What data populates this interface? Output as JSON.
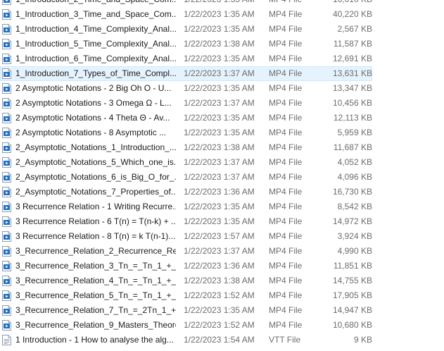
{
  "files": [
    {
      "name": "1_Introduction_2_Time_and_Space_Com...",
      "date": "1/22/2023 1:35 AM",
      "type": "MP4 File",
      "size": "16,010 KB",
      "icon": "video-file-icon",
      "selected": false
    },
    {
      "name": "1_Introduction_3_Time_and_Space_Com...",
      "date": "1/22/2023 1:35 AM",
      "type": "MP4 File",
      "size": "40,220 KB",
      "icon": "video-file-icon",
      "selected": false
    },
    {
      "name": "1_Introduction_4_Time_Complexity_Anal...",
      "date": "1/22/2023 1:35 AM",
      "type": "MP4 File",
      "size": "2,567 KB",
      "icon": "video-file-icon",
      "selected": false
    },
    {
      "name": "1_Introduction_5_Time_Complexity_Anal...",
      "date": "1/22/2023 1:38 AM",
      "type": "MP4 File",
      "size": "11,587 KB",
      "icon": "video-file-icon",
      "selected": false
    },
    {
      "name": "1_Introduction_6_Time_Complexity_Anal...",
      "date": "1/22/2023 1:35 AM",
      "type": "MP4 File",
      "size": "12,691 KB",
      "icon": "video-file-icon",
      "selected": false
    },
    {
      "name": "1_Introduction_7_Types_of_Time_Compl...",
      "date": "1/22/2023 1:37 AM",
      "type": "MP4 File",
      "size": "13,631 KB",
      "icon": "video-file-icon",
      "selected": true
    },
    {
      "name": "2 Asymptotic Notations - 2 Big Oh O - U...",
      "date": "1/22/2023 1:35 AM",
      "type": "MP4 File",
      "size": "13,347 KB",
      "icon": "video-file-icon",
      "selected": false
    },
    {
      "name": "2 Asymptotic Notations - 3 Omega Ω - L...",
      "date": "1/22/2023 1:37 AM",
      "type": "MP4 File",
      "size": "10,456 KB",
      "icon": "video-file-icon",
      "selected": false
    },
    {
      "name": "2 Asymptotic Notations - 4 Theta Θ - Av...",
      "date": "1/22/2023 1:35 AM",
      "type": "MP4 File",
      "size": "12,113 KB",
      "icon": "video-file-icon",
      "selected": false
    },
    {
      "name": "2 Asymptotic Notations - 8 Asymptotic ...",
      "date": "1/22/2023 1:35 AM",
      "type": "MP4 File",
      "size": "5,959 KB",
      "icon": "video-file-icon",
      "selected": false
    },
    {
      "name": "2_Asymptotic_Notations_1_Introduction_...",
      "date": "1/22/2023 1:38 AM",
      "type": "MP4 File",
      "size": "11,687 KB",
      "icon": "video-file-icon",
      "selected": false
    },
    {
      "name": "2_Asymptotic_Notations_5_Which_one_is...",
      "date": "1/22/2023 1:37 AM",
      "type": "MP4 File",
      "size": "4,052 KB",
      "icon": "video-file-icon",
      "selected": false
    },
    {
      "name": "2_Asymptotic_Notations_6_is_Big_O_for_...",
      "date": "1/22/2023 1:37 AM",
      "type": "MP4 File",
      "size": "4,096 KB",
      "icon": "video-file-icon",
      "selected": false
    },
    {
      "name": "2_Asymptotic_Notations_7_Properties_of...",
      "date": "1/22/2023 1:36 AM",
      "type": "MP4 File",
      "size": "16,730 KB",
      "icon": "video-file-icon",
      "selected": false
    },
    {
      "name": "3 Recurrence Relation - 1 Writing Recurre...",
      "date": "1/22/2023 1:35 AM",
      "type": "MP4 File",
      "size": "8,542 KB",
      "icon": "video-file-icon",
      "selected": false
    },
    {
      "name": "3 Recurrence Relation - 6 T(n) = T(n-k) + ...",
      "date": "1/22/2023 1:35 AM",
      "type": "MP4 File",
      "size": "14,972 KB",
      "icon": "video-file-icon",
      "selected": false
    },
    {
      "name": "3 Recurrence Relation - 8 T(n) = k T(n-1)...",
      "date": "1/22/2023 1:57 AM",
      "type": "MP4 File",
      "size": "3,924 KB",
      "icon": "video-file-icon",
      "selected": false
    },
    {
      "name": "3_Recurrence_Relation_2_Recurrence_Rel...",
      "date": "1/22/2023 1:37 AM",
      "type": "MP4 File",
      "size": "4,990 KB",
      "icon": "video-file-icon",
      "selected": false
    },
    {
      "name": "3_Recurrence_Relation_3_Tn_=_Tn_1_+_1...",
      "date": "1/22/2023 1:36 AM",
      "type": "MP4 File",
      "size": "11,851 KB",
      "icon": "video-file-icon",
      "selected": false
    },
    {
      "name": "3_Recurrence_Relation_4_Tn_=_Tn_1_+_n...",
      "date": "1/22/2023 1:38 AM",
      "type": "MP4 File",
      "size": "14,755 KB",
      "icon": "video-file-icon",
      "selected": false
    },
    {
      "name": "3_Recurrence_Relation_5_Tn_=_Tn_1_+_lo...",
      "date": "1/22/2023 1:52 AM",
      "type": "MP4 File",
      "size": "17,905 KB",
      "icon": "video-file-icon",
      "selected": false
    },
    {
      "name": "3_Recurrence_Relation_7_Tn_=_2Tn_1_+_...",
      "date": "1/22/2023 1:35 AM",
      "type": "MP4 File",
      "size": "14,947 KB",
      "icon": "video-file-icon",
      "selected": false
    },
    {
      "name": "3_Recurrence_Relation_9_Masters_Theore...",
      "date": "1/22/2023 1:52 AM",
      "type": "MP4 File",
      "size": "10,680 KB",
      "icon": "video-file-icon",
      "selected": false
    },
    {
      "name": "1 Introduction - 1 How to analyse the alg...",
      "date": "1/22/2023 1:54 AM",
      "type": "VTT File",
      "size": "9 KB",
      "icon": "text-file-icon",
      "selected": false
    }
  ],
  "colors": {
    "selected_bg": "#e5f3ff",
    "selected_border": "#cce8ff",
    "video_icon_blue": "#1f6fc4",
    "secondary_text": "#6d6d6d"
  }
}
